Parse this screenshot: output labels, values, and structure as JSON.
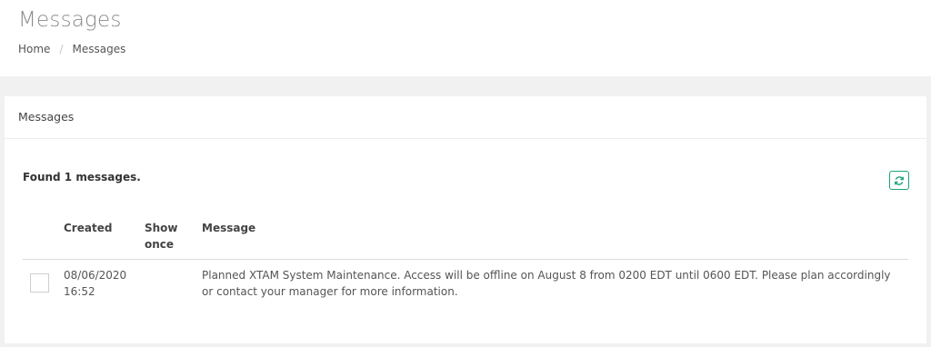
{
  "header": {
    "title": "Messages",
    "breadcrumb": [
      {
        "label": "Home"
      },
      {
        "label": "Messages"
      }
    ],
    "separator": "/"
  },
  "panel": {
    "title": "Messages",
    "found_text": "Found 1 messages.",
    "refresh_icon": "refresh-icon",
    "accent_color": "#1aa37a"
  },
  "table": {
    "columns": [
      "Created",
      "Show once",
      "Message"
    ],
    "rows": [
      {
        "created": "08/06/2020 16:52",
        "show_once": "",
        "message": "Planned XTAM System Maintenance. Access will be offline on August 8 from 0200 EDT until 0600 EDT. Please plan accordingly or contact your manager for more information.",
        "checked": false
      }
    ]
  }
}
